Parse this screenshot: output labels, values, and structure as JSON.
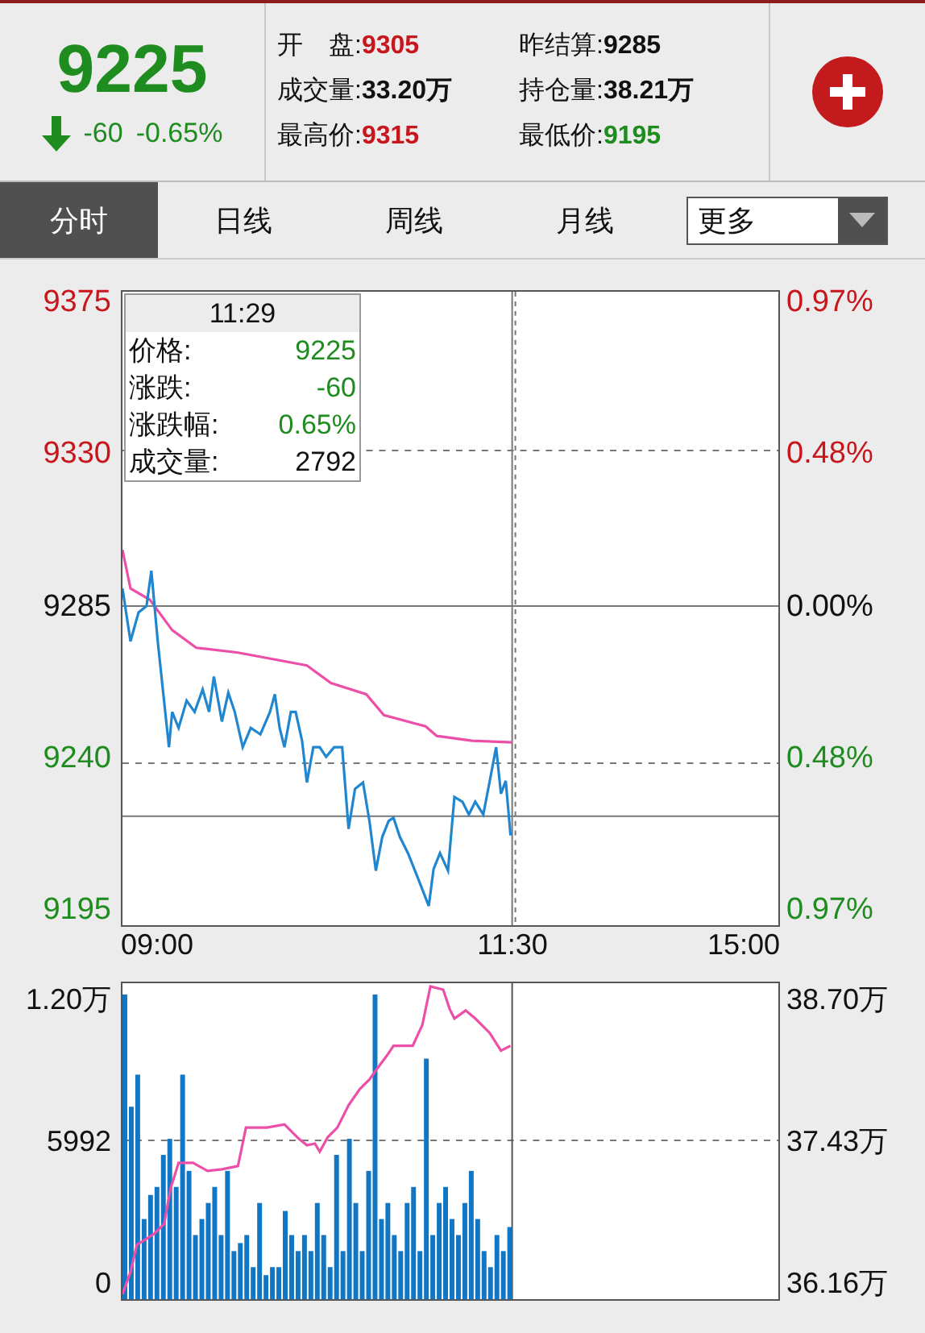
{
  "quote": {
    "price": "9225",
    "falling": true,
    "color": "#1e8c1e",
    "change": "-60",
    "change_pct": "-0.65%"
  },
  "stats": [
    {
      "label": "开　盘:",
      "value": "9305",
      "color": "#c8161d"
    },
    {
      "label": "昨结算:",
      "value": "9285",
      "color": "#111111"
    },
    {
      "label": "成交量:",
      "value": "33.20万",
      "color": "#111111"
    },
    {
      "label": "持仓量:",
      "value": "38.21万",
      "color": "#111111"
    },
    {
      "label": "最高价:",
      "value": "9315",
      "color": "#c8161d"
    },
    {
      "label": "最低价:",
      "value": "9195",
      "color": "#1e8c1e"
    }
  ],
  "tabs": [
    {
      "label": "分时",
      "selected": true
    },
    {
      "label": "日线",
      "selected": false
    },
    {
      "label": "周线",
      "selected": false
    },
    {
      "label": "月线",
      "selected": false
    }
  ],
  "more_dropdown": {
    "value": "更多"
  },
  "price_chart": {
    "tooltip": {
      "time": "11:29",
      "rows": [
        {
          "label": "价格:",
          "value": "9225",
          "color": "#1e8c1e"
        },
        {
          "label": "涨跌:",
          "value": "-60",
          "color": "#1e8c1e"
        },
        {
          "label": "涨跌幅:",
          "value": "0.65%",
          "color": "#1e8c1e"
        },
        {
          "label": "成交量:",
          "value": "2792",
          "color": "#111111"
        }
      ]
    },
    "left_axis": [
      {
        "label": "9375",
        "color": "#c8161d"
      },
      {
        "label": "9330",
        "color": "#c8161d"
      },
      {
        "label": "9285",
        "color": "#111111"
      },
      {
        "label": "9240",
        "color": "#1e8c1e"
      },
      {
        "label": "9195",
        "color": "#1e8c1e"
      }
    ],
    "right_axis": [
      {
        "label": "0.97%",
        "color": "#c8161d"
      },
      {
        "label": "0.48%",
        "color": "#c8161d"
      },
      {
        "label": "0.00%",
        "color": "#111111"
      },
      {
        "label": "0.48%",
        "color": "#1e8c1e"
      },
      {
        "label": "0.97%",
        "color": "#1e8c1e"
      }
    ],
    "time_axis": [
      "09:00",
      "11:30",
      "15:00"
    ]
  },
  "volume_chart": {
    "left_axis": [
      "1.20万",
      "5992",
      "0"
    ],
    "right_axis": [
      "38.70万",
      "37.43万",
      "36.16万"
    ]
  }
}
